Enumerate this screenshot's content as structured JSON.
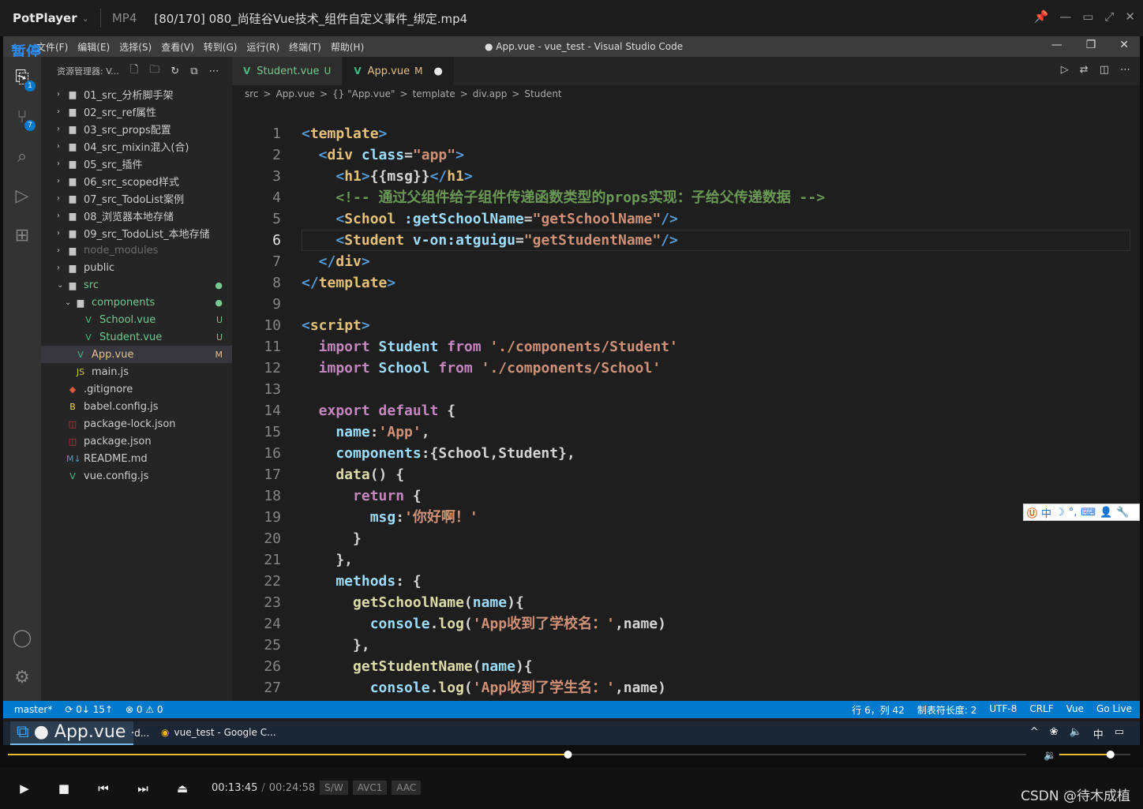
{
  "player": {
    "logo": "PotPlayer",
    "format": "MP4",
    "file": "[80/170] 080_尚硅谷Vue技术_组件自定义事件_绑定.mp4",
    "pause_label": "暂停",
    "time_current": "00:13:45",
    "time_sep": "/",
    "time_total": "00:24:58",
    "tags": [
      "S/W",
      "AVC1",
      "AAC"
    ],
    "progress": 0.55,
    "volume": 0.72,
    "watermark": "CSDN @待木成植"
  },
  "vscode": {
    "window_title": "● App.vue - vue_test - Visual Studio Code",
    "menu": [
      "文件(F)",
      "编辑(E)",
      "选择(S)",
      "查看(V)",
      "转到(G)",
      "运行(R)",
      "终端(T)",
      "帮助(H)"
    ],
    "explorer_title": "资源管理器: V...",
    "scm_badge": "7",
    "explorer_badge": "1",
    "tree": [
      {
        "label": "01_src_分析脚手架",
        "kind": "folder",
        "depth": 0,
        "open": false
      },
      {
        "label": "02_src_ref属性",
        "kind": "folder",
        "depth": 0,
        "open": false
      },
      {
        "label": "03_src_props配置",
        "kind": "folder",
        "depth": 0,
        "open": false
      },
      {
        "label": "04_src_mixin混入(合)",
        "kind": "folder",
        "depth": 0,
        "open": false
      },
      {
        "label": "05_src_插件",
        "kind": "folder",
        "depth": 0,
        "open": false
      },
      {
        "label": "06_src_scoped样式",
        "kind": "folder",
        "depth": 0,
        "open": false
      },
      {
        "label": "07_src_TodoList案例",
        "kind": "folder",
        "depth": 0,
        "open": false
      },
      {
        "label": "08_浏览器本地存储",
        "kind": "folder",
        "depth": 0,
        "open": false
      },
      {
        "label": "09_src_TodoList_本地存储",
        "kind": "folder",
        "depth": 0,
        "open": false
      },
      {
        "label": "node_modules",
        "kind": "folder",
        "depth": 0,
        "open": false,
        "dim": true
      },
      {
        "label": "public",
        "kind": "folder",
        "depth": 0,
        "open": false
      },
      {
        "label": "src",
        "kind": "folder",
        "depth": 0,
        "open": true,
        "status": "●",
        "color": "#73c991"
      },
      {
        "label": "components",
        "kind": "folder",
        "depth": 1,
        "open": true,
        "status": "●",
        "color": "#73c991"
      },
      {
        "label": "School.vue",
        "kind": "vue",
        "depth": 2,
        "status": "U",
        "color": "#73c991"
      },
      {
        "label": "Student.vue",
        "kind": "vue",
        "depth": 2,
        "status": "U",
        "color": "#73c991"
      },
      {
        "label": "App.vue",
        "kind": "vue",
        "depth": 1,
        "status": "M",
        "color": "#e2c08d",
        "selected": true
      },
      {
        "label": "main.js",
        "kind": "js",
        "depth": 1
      },
      {
        "label": ".gitignore",
        "kind": "git",
        "depth": 0
      },
      {
        "label": "babel.config.js",
        "kind": "babel",
        "depth": 0
      },
      {
        "label": "package-lock.json",
        "kind": "npm",
        "depth": 0
      },
      {
        "label": "package.json",
        "kind": "npm",
        "depth": 0
      },
      {
        "label": "README.md",
        "kind": "md",
        "depth": 0
      },
      {
        "label": "vue.config.js",
        "kind": "vue",
        "depth": 0
      }
    ],
    "tabs": [
      {
        "label": "Student.vue",
        "mark": "U",
        "active": false
      },
      {
        "label": "App.vue",
        "mark": "M",
        "active": true,
        "dirty": "●"
      }
    ],
    "breadcrumb": [
      "src",
      ">",
      "App.vue",
      ">",
      "{} \"App.vue\"",
      ">",
      "template",
      ">",
      "div.app",
      ">",
      "Student"
    ],
    "current_line": 6,
    "code": [
      [
        [
          "<",
          "k1"
        ],
        [
          "template",
          "tg"
        ],
        [
          ">",
          "k1"
        ]
      ],
      [
        [
          "  <",
          "k1"
        ],
        [
          "div",
          "tg"
        ],
        [
          " class",
          "at"
        ],
        [
          "=",
          "pl"
        ],
        [
          "\"app\"",
          "str"
        ],
        [
          ">",
          "k1"
        ]
      ],
      [
        [
          "    <",
          "k1"
        ],
        [
          "h1",
          "tg"
        ],
        [
          ">",
          "k1"
        ],
        [
          "{{msg}}",
          "pl"
        ],
        [
          "</",
          "k1"
        ],
        [
          "h1",
          "tg"
        ],
        [
          ">",
          "k1"
        ]
      ],
      [
        [
          "    <!-- 通过父组件给子组件传递函数类型的props实现：子给父传递数据 -->",
          "cm"
        ]
      ],
      [
        [
          "    <",
          "k1"
        ],
        [
          "School",
          "tg"
        ],
        [
          " :getSchoolName",
          "at"
        ],
        [
          "=",
          "pl"
        ],
        [
          "\"getSchoolName\"",
          "str"
        ],
        [
          "/>",
          "k1"
        ]
      ],
      [
        [
          "    <",
          "k1"
        ],
        [
          "Student",
          "tg"
        ],
        [
          " v-on:atguigu",
          "at"
        ],
        [
          "=",
          "pl"
        ],
        [
          "\"getStudentName\"",
          "str"
        ],
        [
          "/>",
          "k1"
        ]
      ],
      [
        [
          "  </",
          "k1"
        ],
        [
          "div",
          "tg"
        ],
        [
          ">",
          "k1"
        ]
      ],
      [
        [
          "</",
          "k1"
        ],
        [
          "template",
          "tg"
        ],
        [
          ">",
          "k1"
        ]
      ],
      [],
      [
        [
          "<",
          "k1"
        ],
        [
          "script",
          "tg"
        ],
        [
          ">",
          "k1"
        ]
      ],
      [
        [
          "  import",
          "k2"
        ],
        [
          " Student ",
          "at"
        ],
        [
          "from",
          "k2"
        ],
        [
          " './components/Student'",
          "str"
        ]
      ],
      [
        [
          "  import",
          "k2"
        ],
        [
          " School ",
          "at"
        ],
        [
          "from",
          "k2"
        ],
        [
          " './components/School'",
          "str"
        ]
      ],
      [],
      [
        [
          "  export default",
          "k2"
        ],
        [
          " {",
          "pl"
        ]
      ],
      [
        [
          "    name",
          "at"
        ],
        [
          ":",
          "pl"
        ],
        [
          "'App'",
          "str"
        ],
        [
          ",",
          "pl"
        ]
      ],
      [
        [
          "    components",
          "at"
        ],
        [
          ":{School,Student},",
          "pl"
        ]
      ],
      [
        [
          "    data",
          "fn"
        ],
        [
          "() {",
          "pl"
        ]
      ],
      [
        [
          "      return",
          "k2"
        ],
        [
          " {",
          "pl"
        ]
      ],
      [
        [
          "        msg",
          "at"
        ],
        [
          ":",
          "pl"
        ],
        [
          "'你好啊！'",
          "str"
        ]
      ],
      [
        [
          "      }",
          "pl"
        ]
      ],
      [
        [
          "    },",
          "pl"
        ]
      ],
      [
        [
          "    methods",
          "at"
        ],
        [
          ": {",
          "pl"
        ]
      ],
      [
        [
          "      getSchoolName",
          "fn"
        ],
        [
          "(",
          "pl"
        ],
        [
          "name",
          "at"
        ],
        [
          "){",
          "pl"
        ]
      ],
      [
        [
          "        console",
          "at"
        ],
        [
          ".",
          "pl"
        ],
        [
          "log",
          "fn"
        ],
        [
          "(",
          "pl"
        ],
        [
          "'App收到了学校名：'",
          "str"
        ],
        [
          ",name)",
          "pl"
        ]
      ],
      [
        [
          "      },",
          "pl"
        ]
      ],
      [
        [
          "      getStudentName",
          "fn"
        ],
        [
          "(",
          "pl"
        ],
        [
          "name",
          "at"
        ],
        [
          "){",
          "pl"
        ]
      ],
      [
        [
          "        console",
          "at"
        ],
        [
          ".",
          "pl"
        ],
        [
          "log",
          "fn"
        ],
        [
          "(",
          "pl"
        ],
        [
          "'App收到了学生名：'",
          "str"
        ],
        [
          ",name)",
          "pl"
        ]
      ],
      [
        [
          "      }",
          "pl"
        ]
      ]
    ],
    "status_left": [
      "master*",
      "⟳ 0↓ 15↑",
      "⊗ 0 ⚠ 0"
    ],
    "status_right": [
      "行 6，列 42",
      "制表符长度: 2",
      "UTF-8",
      "CRLF",
      "Vue",
      "Go Live"
    ]
  },
  "ime": [
    "中",
    "☽",
    "°,",
    "⌨",
    "👤",
    "🔧"
  ],
  "taskbar": [
    {
      "label": "尚硅谷_Vue全家桶.d...",
      "icon": "W",
      "active": false
    },
    {
      "label": "vue_test - Google C...",
      "icon": "◉",
      "active": false
    },
    {
      "label": "● App.vue - vue_tes...",
      "icon": "⧉",
      "active": true
    }
  ],
  "tray": [
    "^",
    "❀",
    "🔈",
    "中",
    "▭"
  ]
}
